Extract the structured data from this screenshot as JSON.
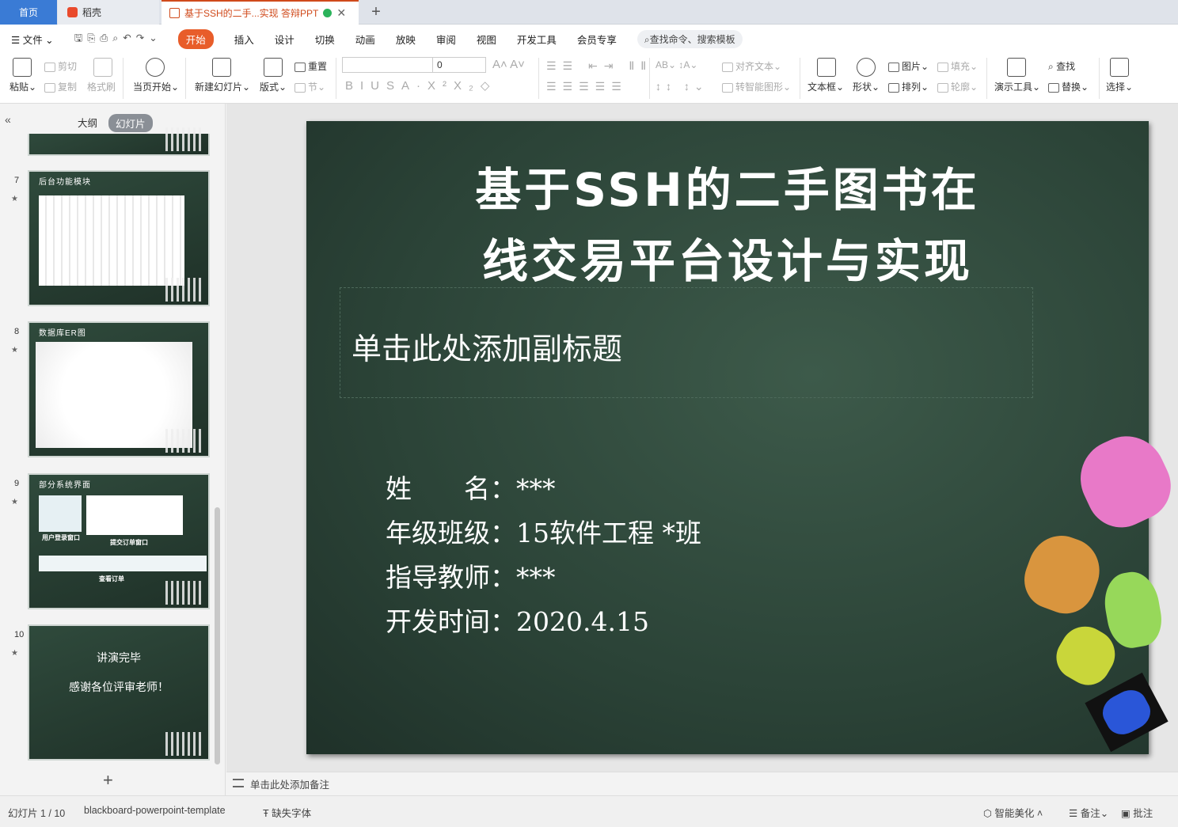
{
  "tabs": {
    "home": "首页",
    "daoke": "稻壳",
    "doc": "基于SSH的二手...实现 答辩PPT",
    "add": "+"
  },
  "menu": {
    "file": "文件",
    "items": [
      "开始",
      "插入",
      "设计",
      "切换",
      "动画",
      "放映",
      "审阅",
      "视图",
      "开发工具",
      "会员专享"
    ],
    "search": "查找命令、搜索模板"
  },
  "ribbon": {
    "paste": "粘贴",
    "cut": "剪切",
    "copy": "复制",
    "format_painter": "格式刷",
    "from_start": "当页开始",
    "new_slide": "新建幻灯片",
    "layout": "版式",
    "reset": "重置",
    "section": "节",
    "font_size": "0",
    "align_text": "对齐文本",
    "smart_art": "转智能图形",
    "textbox": "文本框",
    "shape": "形状",
    "picture": "图片",
    "arrange": "排列",
    "fill": "填充",
    "outline": "轮廓",
    "present_tools": "演示工具",
    "find": "查找",
    "replace": "替换",
    "select": "选择"
  },
  "pane": {
    "outline": "大纲",
    "slides": "幻灯片",
    "add": "+"
  },
  "thumbs": [
    {
      "num": "7",
      "title": "后台功能模块"
    },
    {
      "num": "8",
      "title": "数据库ER图"
    },
    {
      "num": "9",
      "title": "部分系统界面",
      "cap1": "用户登录窗口",
      "cap2": "提交订单窗口",
      "cap3": "查看订单"
    },
    {
      "num": "10",
      "line1": "讲演完毕",
      "line2": "感谢各位评审老师！"
    }
  ],
  "slide": {
    "title1": "基于SSH的二手图书在",
    "title2": "线交易平台设计与实现",
    "subtitle": "单击此处添加副标题",
    "info": [
      "姓　　名：***",
      "年级班级：15软件工程 *班",
      "指导教师：***",
      "开发时间：2020.4.15"
    ]
  },
  "notes": "单击此处添加备注",
  "status": {
    "slide": "幻灯片 1 / 10",
    "template": "blackboard-powerpoint-template",
    "missing_font": "缺失字体",
    "beautify": "智能美化",
    "notes": "备注",
    "comment": "批注"
  },
  "colors": {
    "accent": "#e85d2a",
    "board": "#2b4337"
  }
}
